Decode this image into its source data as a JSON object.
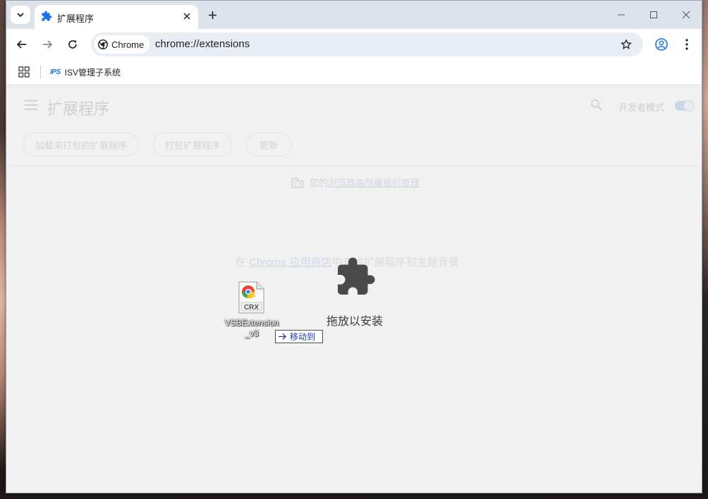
{
  "tab": {
    "title": "扩展程序"
  },
  "toolbar": {
    "chip_label": "Chrome",
    "url": "chrome://extensions"
  },
  "bookmarks": [
    {
      "label": "ISV管理子系统",
      "icon_text": "IPS"
    }
  ],
  "page": {
    "title": "扩展程序",
    "dev_mode_label": "开发者模式",
    "buttons": [
      "加载未打包的扩展程序",
      "打包扩展程序",
      "更新"
    ],
    "managed_prefix": "您的",
    "managed_link": "浏览器由所属组织管理",
    "store_prefix": "在 ",
    "store_link": "Chrome 应用商店",
    "store_suffix": "中查找扩展程序和主题背景",
    "drop_label": "拖放以安装"
  },
  "drag": {
    "file_name": "VSBExtension_v3",
    "file_badge": "CRX",
    "tooltip": "移动到"
  },
  "colors": {
    "accent": "#1a73e8",
    "tabstrip": "#dde3ea",
    "omnibox": "#e9eef6",
    "content_bg": "#f1f1f1"
  }
}
